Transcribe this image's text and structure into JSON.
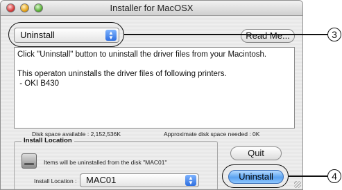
{
  "window": {
    "title": "Installer for MacOSX"
  },
  "toolbar": {
    "mode_select_value": "Uninstall",
    "read_me_label": "Read Me..."
  },
  "info": {
    "line1": "Click \"Uninstall\" button to uninstall the driver files from your Macintosh.",
    "line2": "This operaton uninstalls the driver files of following printers.",
    "line3": " - OKI B430"
  },
  "disk": {
    "available": "Disk space available : 2,152,536K",
    "needed": "Approximate disk space needed : 0K"
  },
  "install_location": {
    "title": "Install Location",
    "items_text": "Items will be uninstalled from the disk \"MAC01\"",
    "label": "Install Location :",
    "value": "MAC01"
  },
  "buttons": {
    "quit": "Quit",
    "uninstall": "Uninstall"
  },
  "callouts": {
    "n3": "3",
    "n4": "4"
  }
}
